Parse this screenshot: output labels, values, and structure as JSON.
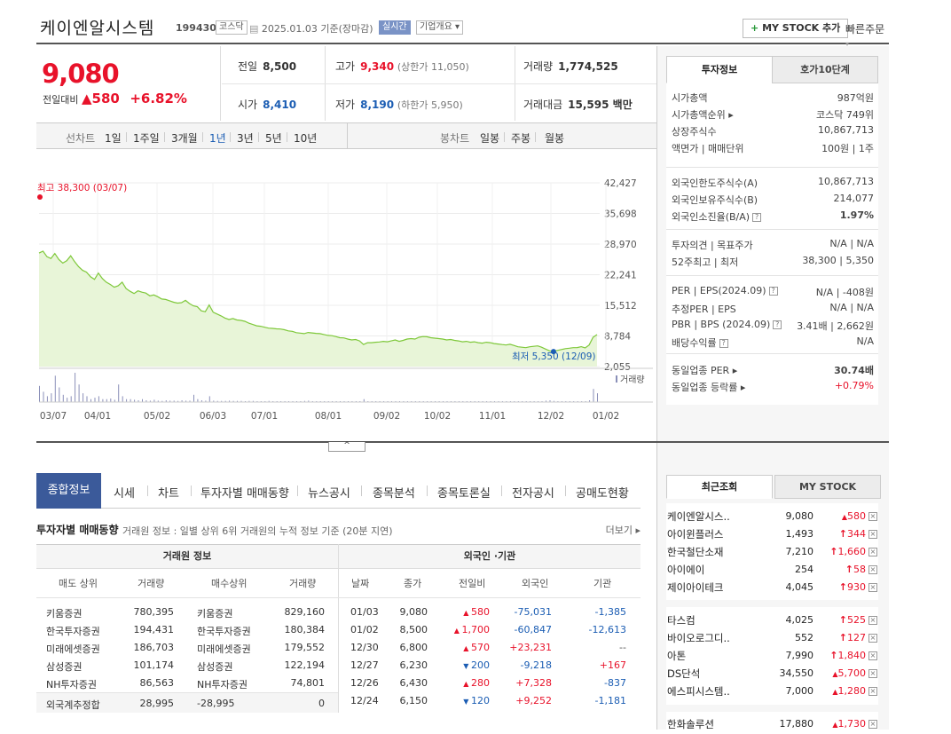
{
  "header": {
    "name": "케이엔알시스템",
    "code": "199430",
    "market_badge": "코스닥",
    "date_text": "2025.01.03 기준(장마감)",
    "realtime_badge": "실시간",
    "company_badge": "기업개요 ▾",
    "mystock_button": "MY STOCK 추가",
    "quick_order": "빠른주문"
  },
  "price": {
    "current": "9,080",
    "change_label": "전일대비",
    "change": "580",
    "change_pct": "+6.82%"
  },
  "stats": {
    "prev_label": "전일",
    "prev": "8,500",
    "high_label": "고가",
    "high": "9,340",
    "upper_limit": "(상한가 11,050)",
    "volume_label": "거래량",
    "volume": "1,774,525",
    "open_label": "시가",
    "open": "8,410",
    "low_label": "저가",
    "low": "8,190",
    "lower_limit": "(하한가 5,950)",
    "value_label": "거래대금",
    "value": "15,595 백만"
  },
  "chart_tabs": {
    "line_label": "선차트",
    "periods": [
      "1일",
      "1주일",
      "3개월",
      "1년",
      "3년",
      "5년",
      "10년"
    ],
    "selected_period": "1년",
    "candle_label": "봉차트",
    "candles": [
      "일봉",
      "주봉",
      "월봉"
    ]
  },
  "chart_data": {
    "type": "area",
    "y_ticks": [
      "42,427",
      "35,698",
      "28,970",
      "22,241",
      "15,512",
      "8,784",
      "2,055"
    ],
    "ylim": [
      2055,
      42427
    ],
    "x_ticks": [
      "03/07",
      "04/01",
      "05/02",
      "06/03",
      "07/01",
      "08/01",
      "09/02",
      "10/02",
      "11/01",
      "12/02",
      "01/02"
    ],
    "high_annotation": "최고 38,300 (03/07)",
    "low_annotation": "최저 5,350 (12/09)",
    "volume_label": "거래량",
    "series": [
      {
        "values": [
          27000,
          27400,
          26200,
          25800,
          26900,
          25600,
          24800,
          25300,
          26400,
          25100,
          24000,
          23200,
          22800,
          21800,
          21200,
          22600,
          21400,
          20600,
          20100,
          19500,
          19800,
          20600,
          19200,
          18600,
          18100,
          18700,
          18400,
          18200,
          17600,
          17800,
          17400,
          16900,
          16800,
          16500,
          16200,
          16000,
          16100,
          16600,
          15900,
          15400,
          15200,
          14300,
          14100,
          15600,
          14000,
          13600,
          13200,
          12700,
          12400,
          12600,
          12300,
          12200,
          12000,
          11600,
          11300,
          11000,
          10900,
          10700,
          10500,
          10450,
          10350,
          10300,
          10150,
          9900,
          9800,
          9500,
          9400,
          9300,
          9550,
          9450,
          9350,
          9300,
          9100,
          8900,
          8850,
          8650,
          8400,
          8350,
          8100,
          7900,
          8000,
          7700,
          6900,
          7300,
          7300,
          7400,
          7450,
          7600,
          7500,
          7700,
          7900,
          7600,
          7800,
          8100,
          8200,
          8100,
          8500,
          8650,
          8600,
          8400,
          8300,
          8200,
          8100,
          7900,
          8000,
          7800,
          7700,
          7500,
          7600,
          7400,
          7500,
          7300,
          7200,
          7400,
          7300,
          7100,
          7000,
          6900,
          6800,
          6950,
          6700,
          6400,
          6300,
          6200,
          6400,
          6500,
          6600,
          6300,
          5900,
          5500,
          5350,
          5600,
          5800,
          6000,
          6100,
          6200,
          6230,
          6430,
          6150,
          6800,
          8500,
          9080
        ]
      }
    ],
    "volume": [
      0.55,
      0.35,
      0.2,
      0.3,
      0.9,
      0.5,
      0.25,
      0.15,
      0.2,
      1.0,
      0.6,
      0.3,
      0.2,
      0.1,
      0.15,
      0.2,
      0.1,
      0.1,
      0.12,
      0.08,
      0.6,
      0.2,
      0.1,
      0.1,
      0.08,
      0.06,
      0.1,
      0.06,
      0.05,
      0.08,
      0.05,
      0.04,
      0.06,
      0.05,
      0.05,
      0.04,
      0.06,
      0.05,
      0.05,
      0.25,
      0.1,
      0.06,
      0.05,
      0.2,
      0.05,
      0.04,
      0.04,
      0.04,
      0.05,
      0.04,
      0.04,
      0.04,
      0.03,
      0.04,
      0.04,
      0.03,
      0.03,
      0.03,
      0.04,
      0.03,
      0.03,
      0.03,
      0.03,
      0.03,
      0.03,
      0.03,
      0.03,
      0.04,
      0.05,
      0.03,
      0.03,
      0.03,
      0.03,
      0.03,
      0.03,
      0.03,
      0.03,
      0.03,
      0.03,
      0.03,
      0.03,
      0.03,
      0.1,
      0.03,
      0.03,
      0.03,
      0.03,
      0.03,
      0.03,
      0.03,
      0.03,
      0.03,
      0.03,
      0.03,
      0.03,
      0.03,
      0.03,
      0.03,
      0.03,
      0.03,
      0.03,
      0.03,
      0.03,
      0.03,
      0.03,
      0.03,
      0.03,
      0.03,
      0.03,
      0.03,
      0.03,
      0.03,
      0.03,
      0.03,
      0.03,
      0.03,
      0.03,
      0.03,
      0.03,
      0.03,
      0.03,
      0.03,
      0.03,
      0.03,
      0.03,
      0.03,
      0.03,
      0.03,
      0.05,
      0.06,
      0.04,
      0.03,
      0.03,
      0.03,
      0.03,
      0.03,
      0.03,
      0.03,
      0.03,
      0.06,
      0.45,
      0.3
    ]
  },
  "right": {
    "tab_info": "투자정보",
    "tab_hoga": "호가10단계",
    "rows1": [
      {
        "k": "시가총액",
        "v": "987억원"
      },
      {
        "k": "시가총액순위 ▸",
        "v": "코스닥 749위"
      },
      {
        "k": "상장주식수",
        "v": "10,867,713"
      },
      {
        "k": "액면가 | 매매단위",
        "v": "100원 | 1주"
      }
    ],
    "rows2": [
      {
        "k": "외국인한도주식수(A)",
        "v": "10,867,713"
      },
      {
        "k": "외국인보유주식수(B)",
        "v": "214,077"
      },
      {
        "k": "외국인소진율(B/A)",
        "v": "1.97%"
      }
    ],
    "rows3": [
      {
        "k": "투자의견 | 목표주가",
        "v": "N/A | N/A"
      },
      {
        "k": "52주최고 | 최저",
        "v": "38,300 | 5,350"
      }
    ],
    "rows4": [
      {
        "k": "PER | EPS(2024.09)",
        "v": "N/A | -408원"
      },
      {
        "k": "추정PER | EPS",
        "v": "N/A | N/A"
      },
      {
        "k": "PBR | BPS (2024.09)",
        "v": "3.41배 | 2,662원"
      },
      {
        "k": "배당수익률",
        "v": "N/A"
      }
    ],
    "rows5": [
      {
        "k": "동일업종 PER ▸",
        "v": "30.74배"
      },
      {
        "k": "동일업종 등락률 ▸",
        "v": "+0.79%"
      }
    ]
  },
  "bottom_tabs": [
    "종합정보",
    "시세",
    "차트",
    "투자자별 매매동향",
    "뉴스공시",
    "종목분석",
    "종목토론실",
    "전자공시",
    "공매도현황"
  ],
  "sub": {
    "title": "투자자별 매매동향",
    "desc": "거래원 정보 : 일별 상위 6위 거래원의 누적 정보 기준 (20분 지연)",
    "more": "더보기 ▸"
  },
  "broker": {
    "title": "거래원 정보",
    "headers": [
      "매도 상위",
      "거래량",
      "매수상위",
      "거래량"
    ],
    "rows": [
      [
        "키움증권",
        "780,395",
        "키움증권",
        "829,160"
      ],
      [
        "한국투자증권",
        "194,431",
        "한국투자증권",
        "180,384"
      ],
      [
        "미래에셋증권",
        "186,703",
        "미래에셋증권",
        "179,552"
      ],
      [
        "삼성증권",
        "101,174",
        "삼성증권",
        "122,194"
      ],
      [
        "NH투자증권",
        "86,563",
        "NH투자증권",
        "74,801"
      ]
    ],
    "foreign_row": [
      "외국계추정합",
      "28,995",
      "-28,995",
      "0"
    ]
  },
  "foreign": {
    "title": "외국인 ·기관",
    "headers": [
      "날짜",
      "종가",
      "전일비",
      "외국인",
      "기관"
    ],
    "rows": [
      [
        "01/03",
        "9,080",
        "580",
        "-75,031",
        "-1,385"
      ],
      [
        "01/02",
        "8,500",
        "1,700",
        "-60,847",
        "-12,613"
      ],
      [
        "12/30",
        "6,800",
        "570",
        "+23,231",
        "--"
      ],
      [
        "12/27",
        "6,230",
        "200",
        "-9,218",
        "+167"
      ],
      [
        "12/26",
        "6,430",
        "280",
        "+7,328",
        "-837"
      ],
      [
        "12/24",
        "6,150",
        "120",
        "+9,252",
        "-1,181"
      ]
    ]
  },
  "recent": {
    "tab_recent": "최근조회",
    "tab_mystock": "MY STOCK",
    "items": [
      {
        "n": "케이엔알시스..",
        "p": "9,080",
        "c": "580",
        "a": "▲"
      },
      {
        "n": "아이윈플러스",
        "p": "1,493",
        "c": "344",
        "a": "↑"
      },
      {
        "n": "한국철단소재",
        "p": "7,210",
        "c": "1,660",
        "a": "↑"
      },
      {
        "n": "아이에이",
        "p": "254",
        "c": "58",
        "a": "↑"
      },
      {
        "n": "제이아이테크",
        "p": "4,045",
        "c": "930",
        "a": "↑"
      },
      {
        "n": "타스컴",
        "p": "4,025",
        "c": "525",
        "a": "↑"
      },
      {
        "n": "바이오로그디..",
        "p": "552",
        "c": "127",
        "a": "↑"
      },
      {
        "n": "아톤",
        "p": "7,990",
        "c": "1,840",
        "a": "↑"
      },
      {
        "n": "DS단석",
        "p": "34,550",
        "c": "5,700",
        "a": "▲"
      },
      {
        "n": "에스피시스템..",
        "p": "7,000",
        "c": "1,280",
        "a": "▲"
      },
      {
        "n": "한화솔루션",
        "p": "17,880",
        "c": "1,730",
        "a": "▲"
      }
    ]
  }
}
